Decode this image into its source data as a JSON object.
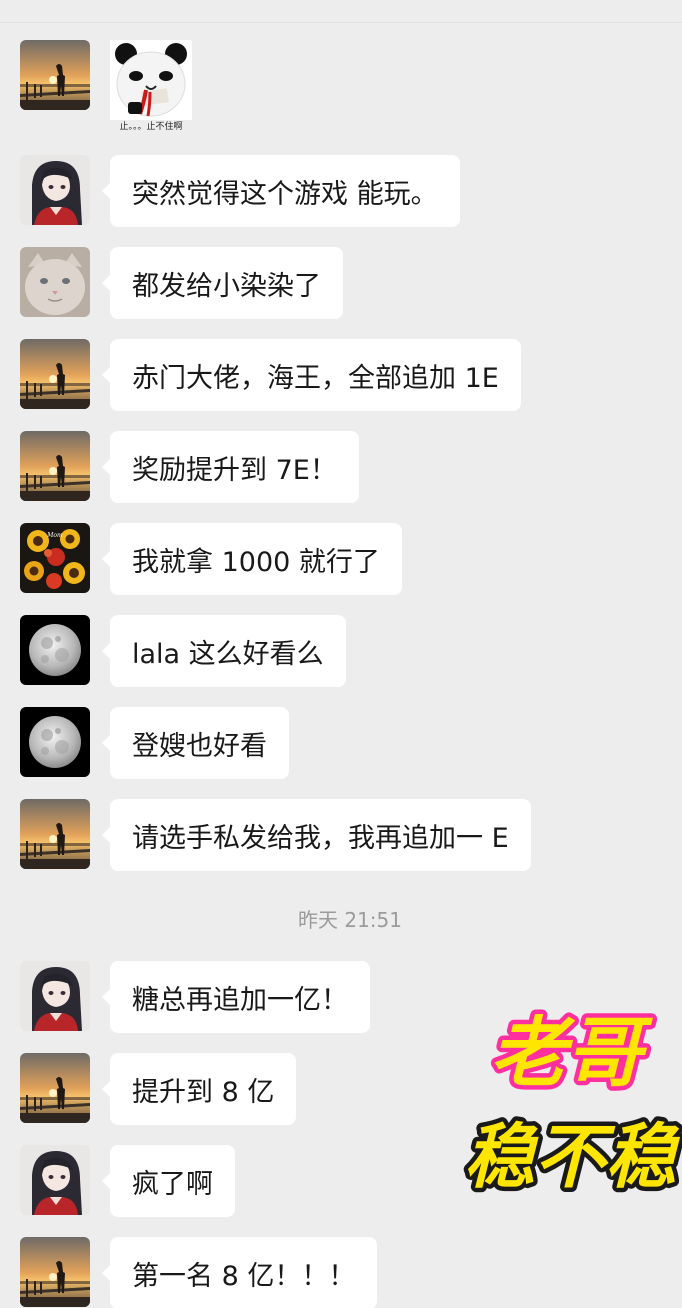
{
  "sticker": {
    "caption": "止。。。止不住啊",
    "icon": "panda-nosebleed-sticker"
  },
  "messages": [
    {
      "text": "突然觉得这个游戏 能玩。",
      "avatar": "anime-girl-avatar"
    },
    {
      "text": "都发给小染染了",
      "avatar": "cat-avatar"
    },
    {
      "text": "赤门大佬，海王，全部追加 1E",
      "avatar": "sunset-lake-avatar"
    },
    {
      "text": "奖励提升到 7E！",
      "avatar": "sunset-lake-avatar"
    },
    {
      "text": "我就拿 1000 就行了",
      "avatar": "sunflower-avatar"
    },
    {
      "text": "lala 这么好看么",
      "avatar": "moon-avatar"
    },
    {
      "text": "登嫂也好看",
      "avatar": "moon-avatar"
    },
    {
      "text": "请选手私发给我，我再追加一 E",
      "avatar": "sunset-lake-avatar"
    },
    {
      "text": "糖总再追加一亿！",
      "avatar": "anime-girl-avatar"
    },
    {
      "text": "提升到 8 亿",
      "avatar": "sunset-lake-avatar"
    },
    {
      "text": "疯了啊",
      "avatar": "anime-girl-avatar"
    },
    {
      "text": "第一名 8 亿！！！",
      "avatar": "sunset-lake-avatar"
    }
  ],
  "timestamp": "昨天 21:51",
  "overlay": {
    "line1": "老哥",
    "line2": "稳不稳"
  },
  "colors": {
    "background": "#ededed",
    "bubble": "#ffffff",
    "text": "#191919",
    "timestamp": "#9b9b9b",
    "overlay_fill": "#ffe600",
    "overlay_outline": "#ff2fa0"
  }
}
